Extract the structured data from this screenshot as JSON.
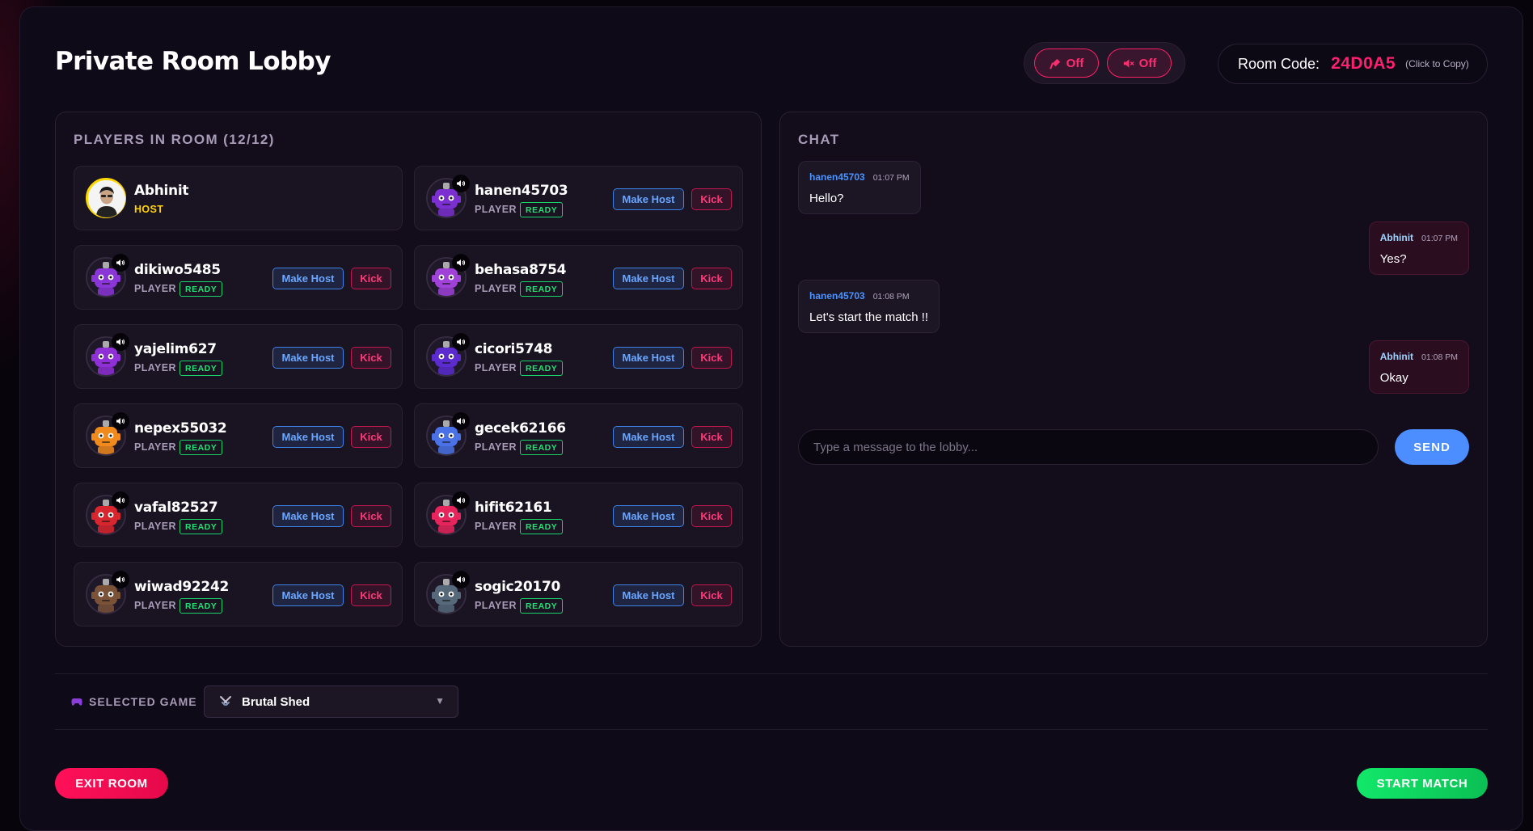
{
  "header": {
    "title": "Private Room Lobby",
    "mic_label": "Off",
    "speaker_label": "Off",
    "room_code_label": "Room Code:",
    "room_code": "24D0A5",
    "room_code_hint": "(Click to Copy)"
  },
  "players": {
    "title": "PLAYERS IN ROOM (12/12)",
    "make_host_label": "Make Host",
    "kick_label": "Kick",
    "ready_label": "READY",
    "list": [
      {
        "name": "Abhinit",
        "role": "HOST",
        "avatar": "host-photo"
      },
      {
        "name": "hanen45703",
        "role": "PLAYER",
        "avatar": "purple-visor-bot",
        "color": "#7b2fd1"
      },
      {
        "name": "dikiwo5485",
        "role": "PLAYER",
        "avatar": "purple-heart-eyes-bot",
        "color": "#8a35d6"
      },
      {
        "name": "behasa8754",
        "role": "PLAYER",
        "avatar": "violet-bot",
        "color": "#a042d8"
      },
      {
        "name": "yajelim627",
        "role": "PLAYER",
        "avatar": "purple-round-eyes-bot",
        "color": "#8f2fd6"
      },
      {
        "name": "cicori5748",
        "role": "PLAYER",
        "avatar": "indigo-bot",
        "color": "#5b2bcf"
      },
      {
        "name": "nepex55032",
        "role": "PLAYER",
        "avatar": "orange-bot",
        "color": "#f08a1c"
      },
      {
        "name": "gecek62166",
        "role": "PLAYER",
        "avatar": "blue-bot",
        "color": "#4a72e6"
      },
      {
        "name": "vafal82527",
        "role": "PLAYER",
        "avatar": "red-bot",
        "color": "#d8262e"
      },
      {
        "name": "hifit62161",
        "role": "PLAYER",
        "avatar": "pink-bot",
        "color": "#e8245c"
      },
      {
        "name": "wiwad92242",
        "role": "PLAYER",
        "avatar": "brown-bot",
        "color": "#7a5238"
      },
      {
        "name": "sogic20170",
        "role": "PLAYER",
        "avatar": "slate-bot",
        "color": "#56697a"
      }
    ]
  },
  "chat": {
    "title": "CHAT",
    "messages": [
      {
        "user": "hanen45703",
        "time": "01:07 PM",
        "text": "Hello?",
        "mine": false
      },
      {
        "user": "Abhinit",
        "time": "01:07 PM",
        "text": "Yes?",
        "mine": true
      },
      {
        "user": "hanen45703",
        "time": "01:08 PM",
        "text": "Let's start the match !!",
        "mine": false
      },
      {
        "user": "Abhinit",
        "time": "01:08 PM",
        "text": "Okay",
        "mine": true
      }
    ],
    "input_placeholder": "Type a message to the lobby...",
    "send_label": "SEND"
  },
  "game": {
    "label": "SELECTED GAME",
    "selected": "Brutal Shed"
  },
  "footer": {
    "exit_label": "EXIT ROOM",
    "start_label": "START MATCH"
  },
  "colors": {
    "accent_pink": "#ff1f6e",
    "ready_green": "#22e074",
    "host_blue": "#4c8dff",
    "host_gold": "#ffd400"
  }
}
